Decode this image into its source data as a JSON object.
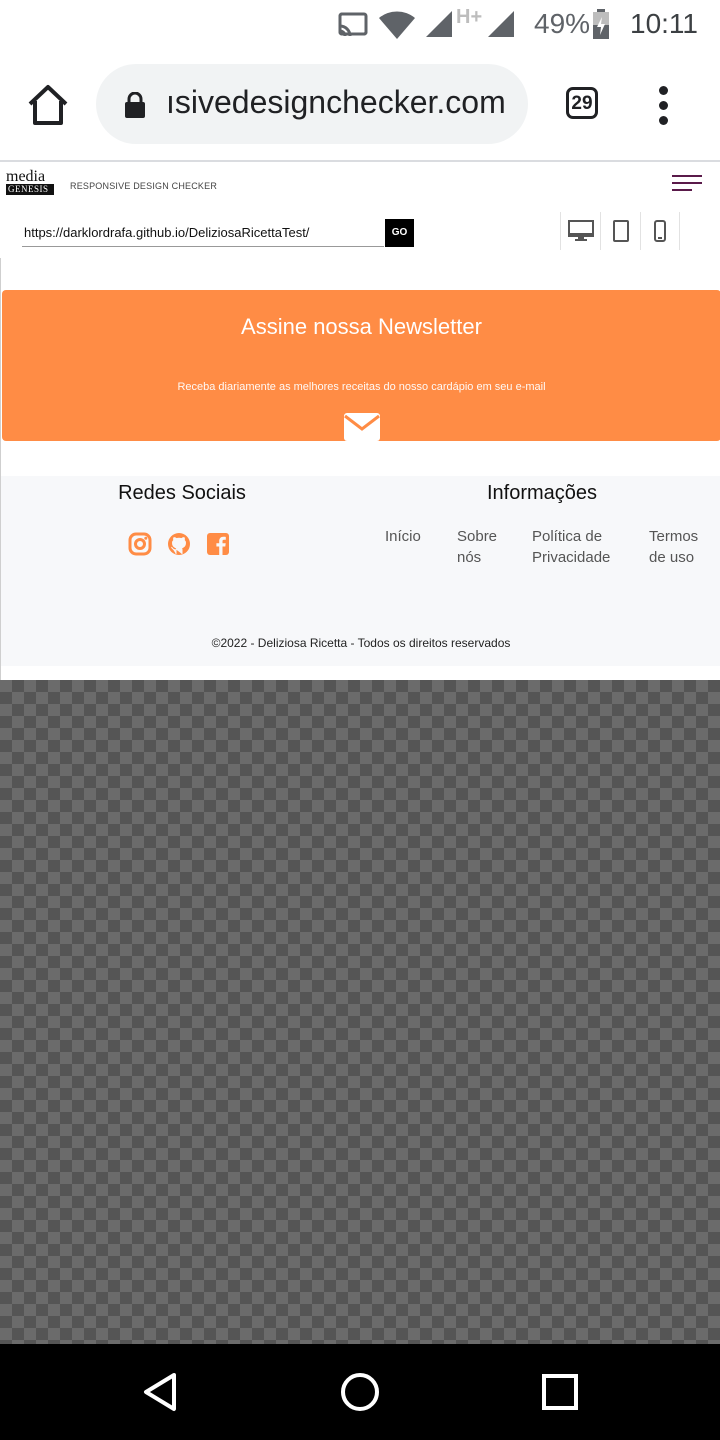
{
  "status_bar": {
    "battery": "49%",
    "network": "H+",
    "time": "10:11",
    "icons": [
      "cast-icon",
      "wifi-icon",
      "signal-icon",
      "signal-icon",
      "battery-icon"
    ]
  },
  "browser": {
    "url": "ısivedesigncheckercom",
    "url_display": "ısivedesignchecker.com",
    "tab_count": "29",
    "icons": [
      "home-icon",
      "lock-icon",
      "more-vert-icon"
    ]
  },
  "site": {
    "logo_top": "media",
    "logo_bottom": "GENESIS",
    "title": "RESPONSIVE DESIGN CHECKER",
    "test_url": "https://darklordrafa.github.io/DeliziosaRicettaTest/",
    "go_label": "GO",
    "devices": [
      "desktop-icon",
      "tablet-icon",
      "mobile-icon"
    ]
  },
  "preview": {
    "newsletter": {
      "title": "Assine nossa Newsletter",
      "subtitle": "Receba diariamente as melhores receitas do nosso cardápio em seu e-mail",
      "color": "#ff8c45"
    },
    "footer": {
      "social_title": "Redes Sociais",
      "info_title": "Informações",
      "social_icons": [
        "instagram-icon",
        "github-icon",
        "facebook-icon"
      ],
      "info_links": [
        {
          "line1": "Início",
          "line2": ""
        },
        {
          "line1": "Sobre",
          "line2": "nós"
        },
        {
          "line1": "Política de",
          "line2": "Privacidade"
        },
        {
          "line1": "Termos",
          "line2": "de uso"
        }
      ],
      "copyright": "©2022 - Deliziosa Ricetta - Todos os direitos reservados"
    }
  },
  "colors": {
    "accent": "#ff8c45",
    "hamburger": "#5a1a4a"
  }
}
